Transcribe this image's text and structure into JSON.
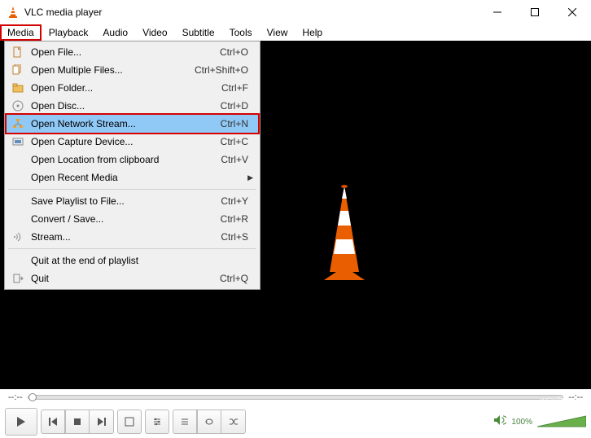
{
  "window": {
    "title": "VLC media player"
  },
  "menubar": [
    "Media",
    "Playback",
    "Audio",
    "Video",
    "Subtitle",
    "Tools",
    "View",
    "Help"
  ],
  "dropdown": {
    "items": [
      {
        "icon": "file",
        "label": "Open File...",
        "shortcut": "Ctrl+O"
      },
      {
        "icon": "files",
        "label": "Open Multiple Files...",
        "shortcut": "Ctrl+Shift+O"
      },
      {
        "icon": "folder",
        "label": "Open Folder...",
        "shortcut": "Ctrl+F"
      },
      {
        "icon": "disc",
        "label": "Open Disc...",
        "shortcut": "Ctrl+D"
      },
      {
        "icon": "network",
        "label": "Open Network Stream...",
        "shortcut": "Ctrl+N",
        "highlighted": true
      },
      {
        "icon": "capture",
        "label": "Open Capture Device...",
        "shortcut": "Ctrl+C"
      },
      {
        "icon": "",
        "label": "Open Location from clipboard",
        "shortcut": "Ctrl+V"
      },
      {
        "icon": "",
        "label": "Open Recent Media",
        "shortcut": "",
        "submenu": true
      },
      {
        "sep": true
      },
      {
        "icon": "",
        "label": "Save Playlist to File...",
        "shortcut": "Ctrl+Y"
      },
      {
        "icon": "",
        "label": "Convert / Save...",
        "shortcut": "Ctrl+R"
      },
      {
        "icon": "stream",
        "label": "Stream...",
        "shortcut": "Ctrl+S"
      },
      {
        "sep": true
      },
      {
        "icon": "",
        "label": "Quit at the end of playlist",
        "shortcut": ""
      },
      {
        "icon": "quit",
        "label": "Quit",
        "shortcut": "Ctrl+Q"
      }
    ]
  },
  "seek": {
    "current": "--:--",
    "total": "--:--"
  },
  "volume": {
    "pct": "100%"
  },
  "watermark": "wsxdn.com"
}
